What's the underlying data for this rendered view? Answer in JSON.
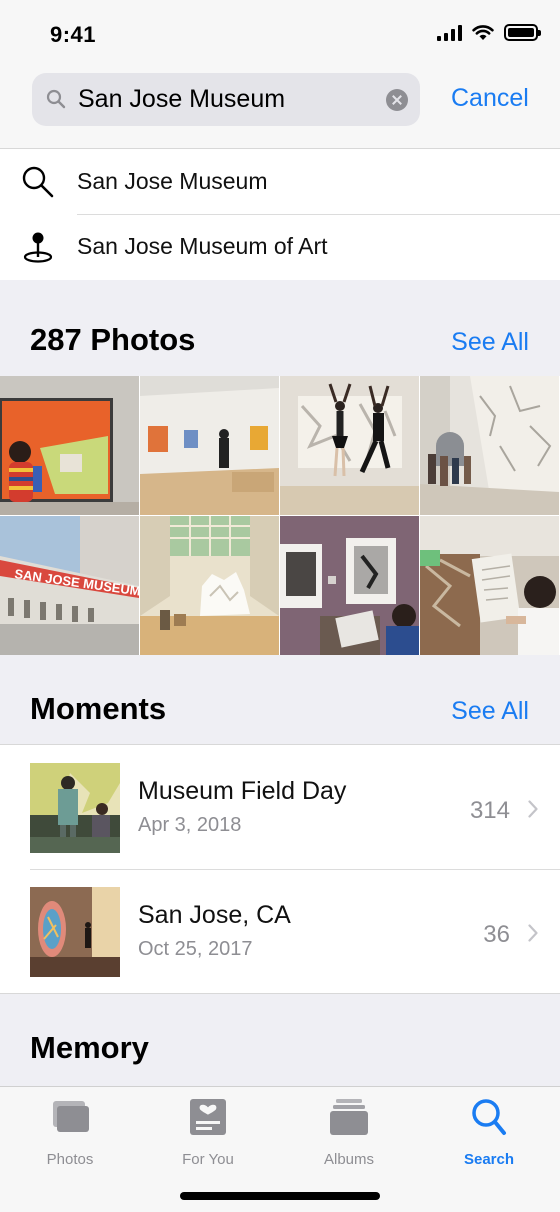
{
  "status_bar": {
    "time": "9:41",
    "icons": [
      "signal-icon",
      "wifi-icon",
      "battery-icon"
    ]
  },
  "search": {
    "query": "San Jose Museum",
    "cancel_label": "Cancel",
    "clear_icon": "clear-icon"
  },
  "suggestions": [
    {
      "icon": "search-icon",
      "label": "San Jose Museum"
    },
    {
      "icon": "location-pin-icon",
      "label": "San Jose Museum of Art"
    }
  ],
  "photos_section": {
    "title": "287 Photos",
    "see_all_label": "See All"
  },
  "moments_section": {
    "title": "Moments",
    "see_all_label": "See All"
  },
  "moments": [
    {
      "title": "Museum Field Day",
      "date": "Apr 3, 2018",
      "count": "314"
    },
    {
      "title": "San Jose, CA",
      "date": "Oct 25, 2017",
      "count": "36"
    }
  ],
  "memory_section": {
    "title": "Memory"
  },
  "tab_bar": {
    "tabs": [
      {
        "label": "Photos",
        "icon": "photos-icon",
        "active": false
      },
      {
        "label": "For You",
        "icon": "for-you-icon",
        "active": false
      },
      {
        "label": "Albums",
        "icon": "albums-icon",
        "active": false
      },
      {
        "label": "Search",
        "icon": "search-icon",
        "active": true
      }
    ]
  },
  "colors": {
    "accent": "#1a7cf2",
    "secondary_text": "#8e8e93",
    "grouped_background": "#efeff4"
  }
}
